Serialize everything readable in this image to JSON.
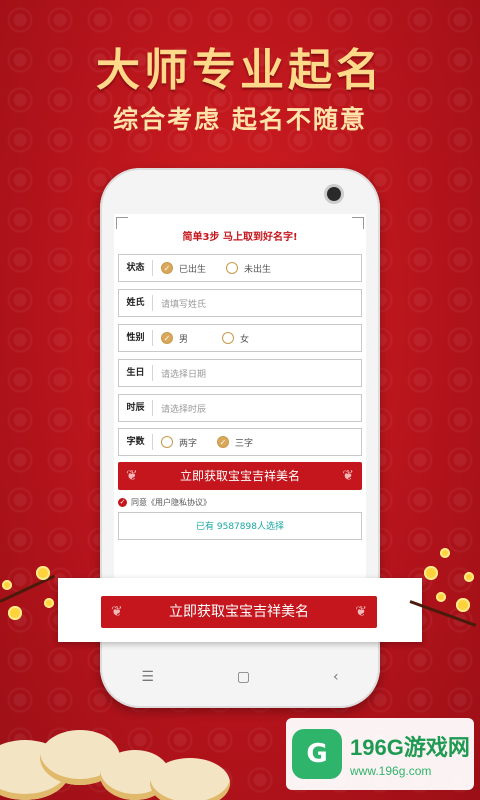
{
  "header": {
    "title": "大师专业起名",
    "subtitle": "综合考虑  起名不随意"
  },
  "form": {
    "steps_title": "简单3步 马上取到好名字!",
    "status": {
      "label": "状态",
      "options": [
        "已出生",
        "未出生"
      ],
      "selected": "已出生"
    },
    "surname": {
      "label": "姓氏",
      "placeholder": "请填写姓氏"
    },
    "gender": {
      "label": "性别",
      "options": [
        "男",
        "女"
      ],
      "selected": "男"
    },
    "birthday": {
      "label": "生日",
      "placeholder": "请选择日期"
    },
    "birth_hour": {
      "label": "时辰",
      "placeholder": "请选择时辰"
    },
    "char_count": {
      "label": "字数",
      "options": [
        "两字",
        "三字"
      ],
      "selected": "三字"
    },
    "submit_label": "立即获取宝宝吉祥美名",
    "agree_text": "同意《用户隐私协议》",
    "count_text": "已有 9587898人选择"
  },
  "cta": {
    "label": "立即获取宝宝吉祥美名"
  },
  "navbar": {
    "menu": "☰",
    "home": "▢",
    "back": "‹"
  },
  "watermark": {
    "brand": "196G游戏网",
    "url": "www.196g.com",
    "icon_text": "G"
  },
  "colors": {
    "primary_red": "#c4161c",
    "gold": "#ffd98a",
    "teal": "#19a8a0"
  }
}
